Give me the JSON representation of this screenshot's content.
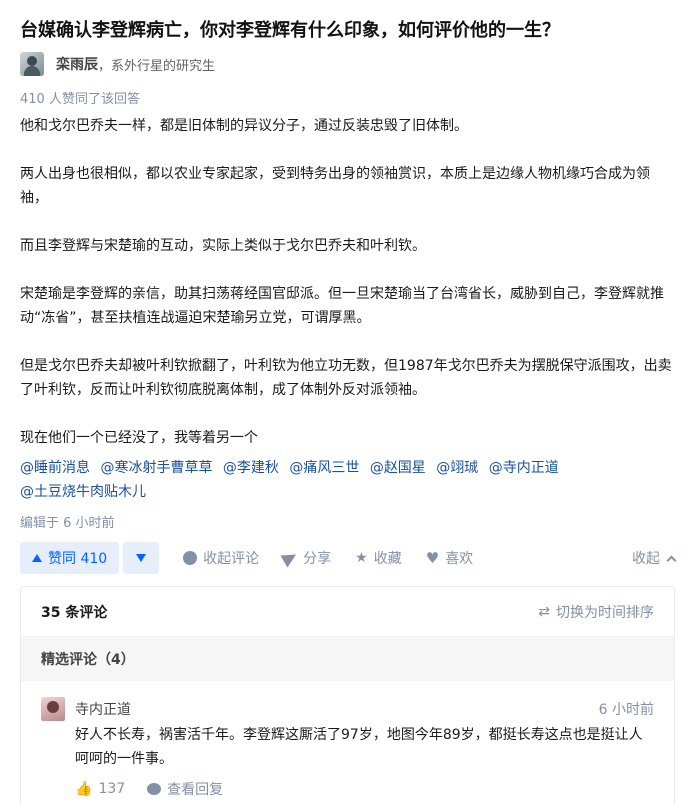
{
  "question": {
    "title": "台媒确认李登辉病亡，你对李登辉有什么印象，如何评价他的一生？"
  },
  "author": {
    "name": "栾雨辰",
    "separator": "，",
    "bio": "系外行星的研究生"
  },
  "answer": {
    "vote_summary": "410 人赞同了该回答",
    "paragraphs": [
      "他和戈尔巴乔夫一样，都是旧体制的异议分子，通过反装忠毁了旧体制。",
      "两人出身也很相似，都以农业专家起家，受到特务出身的领袖赏识，本质上是边缘人物机缘巧合成为领袖，",
      "而且李登辉与宋楚瑜的互动，实际上类似于戈尔巴乔夫和叶利钦。",
      "宋楚瑜是李登辉的亲信，助其扫荡蒋经国官邸派。但一旦宋楚瑜当了台湾省长，威胁到自己，李登辉就推动“冻省”，甚至扶植连战逼迫宋楚瑜另立党，可谓厚黑。",
      "但是戈尔巴乔夫却被叶利钦掀翻了，叶利钦为他立功无数，但1987年戈尔巴乔夫为摆脱保守派围攻，出卖了叶利钦，反而让叶利钦彻底脱离体制，成了体制外反对派领袖。",
      "现在他们一个已经没了，我等着另一个"
    ],
    "mentions": [
      "@睡前消息",
      "@寒冰射手曹草草",
      "@李建秋",
      "@痛风三世",
      "@赵国星",
      "@翊珹",
      "@寺内正道",
      "@土豆烧牛肉贴木儿"
    ],
    "edited": "编辑于 6 小时前"
  },
  "actions": {
    "upvote_label": "赞同 410",
    "comment_label": "收起评论",
    "share_label": "分享",
    "collect_label": "收藏",
    "like_label": "喜欢",
    "collapse_label": "收起"
  },
  "comments": {
    "count_label": "35 条评论",
    "sort_label": "切换为时间排序",
    "featured_label": "精选评论（4）",
    "items": [
      {
        "user": "寺内正道",
        "time": "6 小时前",
        "text": "好人不长寿，祸害活千年。李登辉这厮活了97岁，地图今年89岁，都挺长寿这点也是挺让人呵呵的一件事。",
        "likes": "137",
        "reply_label": "查看回复"
      }
    ]
  },
  "icons": {
    "upvote": "triangle-up-icon",
    "downvote": "triangle-down-icon",
    "comment": "comment-bubble-icon",
    "share": "paper-plane-icon",
    "collect": "star-icon",
    "like": "heart-icon",
    "collapse": "chevron-up-icon",
    "sort": "swap-arrows-icon",
    "thumb": "thumbs-up-icon",
    "reply": "reply-bubble-icon"
  },
  "colors": {
    "accent": "#0066ff",
    "accent_bg": "#e5eefa",
    "link": "#175199",
    "muted": "#8590a6"
  }
}
